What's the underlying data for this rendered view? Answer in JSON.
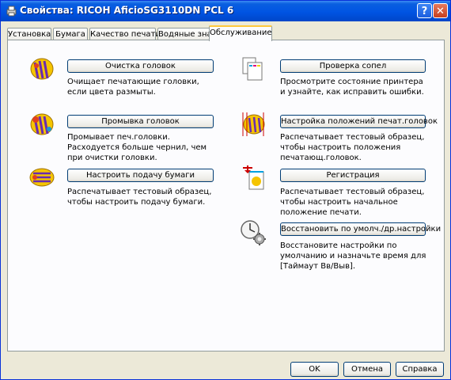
{
  "window": {
    "title": "Свойства: RICOH AficioSG3110DN PCL 6",
    "help_glyph": "?",
    "close_glyph": "✕"
  },
  "tabs": [
    {
      "label": "Установка"
    },
    {
      "label": "Бумага"
    },
    {
      "label": "Качество печати"
    },
    {
      "label": "Водяные знаки"
    },
    {
      "label": "Обслуживание",
      "active": true
    }
  ],
  "maintenance": {
    "head_cleaning": {
      "button": "Очистка головок",
      "description": "Очищает печатающие головки, если цвета размыты."
    },
    "head_flushing": {
      "button": "Промывка головок",
      "description": "Промывает печ.головки. Расходуется больше чернил, чем при очистки головки."
    },
    "paper_feed": {
      "button": "Настроить подачу бумаги",
      "description": "Распечатывает тестовый образец, чтобы настроить подачу бумаги."
    },
    "nozzle_check": {
      "button": "Проверка сопел",
      "description": "Просмотрите состояние принтера и узнайте, как исправить ошибки."
    },
    "head_position": {
      "button": "Настройка положений печат.головок",
      "description": "Распечатывает тестовый образец, чтобы настроить положения печатающ.головок."
    },
    "registration": {
      "button": "Регистрация",
      "description": "Распечатывает тестовый образец, чтобы настроить начальное положение печати."
    },
    "restore_defaults": {
      "button": "Восстановить по умолч./др.настройки",
      "description": "Восстановите настройки по умолчанию и назначьте время для [Таймаут Вв/Выв]."
    }
  },
  "footer": {
    "ok": "OK",
    "cancel": "Отмена",
    "help": "Справка"
  },
  "colors": {
    "title_bar": "#0054e3",
    "tab_highlight": "#ffc83c",
    "dialog_bg": "#ece9d8"
  }
}
